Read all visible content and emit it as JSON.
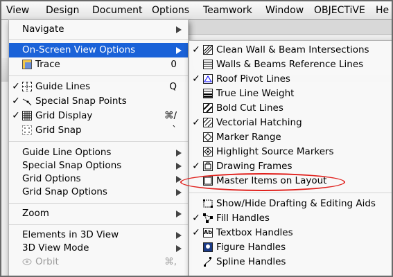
{
  "menubar": {
    "items": [
      "View",
      "Design",
      "Document",
      "Options",
      "Teamwork",
      "Window",
      "OBJECTiVE",
      "He"
    ]
  },
  "view_menu": {
    "items": [
      {
        "label": "Navigate"
      },
      {
        "label": "On-Screen View Options"
      },
      {
        "label": "Trace",
        "shortcut": "0"
      },
      {
        "label": "Guide Lines",
        "check": "✓",
        "shortcut": "Q"
      },
      {
        "label": "Special Snap Points",
        "check": "✓"
      },
      {
        "label": "Grid Display",
        "check": "✓",
        "shortcut": "⌘/"
      },
      {
        "label": "Grid Snap",
        "shortcut": "`"
      },
      {
        "label": "Guide Line Options"
      },
      {
        "label": "Special Snap Options"
      },
      {
        "label": "Grid Options"
      },
      {
        "label": "Grid Snap Options"
      },
      {
        "label": "Zoom"
      },
      {
        "label": "Elements in 3D View"
      },
      {
        "label": "3D View Mode"
      },
      {
        "label": "Orbit",
        "shortcut": "⌘,"
      }
    ]
  },
  "view_options_menu": {
    "items": [
      {
        "label": "Clean Wall & Beam Intersections",
        "check": "✓",
        "icon": "clean-wall-icon"
      },
      {
        "label": "Walls & Beams Reference Lines",
        "icon": "reference-lines-icon"
      },
      {
        "label": "Roof Pivot Lines",
        "check": "✓",
        "icon": "roof-pivot-icon"
      },
      {
        "label": "True Line Weight",
        "icon": "line-weight-icon"
      },
      {
        "label": "Bold Cut Lines",
        "icon": "bold-cut-icon"
      },
      {
        "label": "Vectorial Hatching",
        "check": "✓",
        "icon": "hatching-icon"
      },
      {
        "label": "Marker Range",
        "icon": "marker-range-icon"
      },
      {
        "label": "Highlight Source Markers",
        "icon": "source-marker-icon"
      },
      {
        "label": "Drawing Frames",
        "check": "✓",
        "icon": "drawing-frame-icon"
      },
      {
        "label": "Master Items on Layout",
        "icon": "master-items-icon"
      },
      {
        "label": "Show/Hide Drafting & Editing Aids",
        "icon": "drafting-aids-icon"
      },
      {
        "label": "Fill Handles",
        "check": "✓",
        "icon": "fill-handles-icon"
      },
      {
        "label": "Textbox Handles",
        "check": "✓",
        "icon": "textbox-handles-icon"
      },
      {
        "label": "Figure Handles",
        "icon": "figure-handles-icon"
      },
      {
        "label": "Spline Handles",
        "icon": "spline-handles-icon"
      }
    ]
  },
  "colors": {
    "selection": "#1a62d8",
    "annotation": "#e0201c"
  }
}
